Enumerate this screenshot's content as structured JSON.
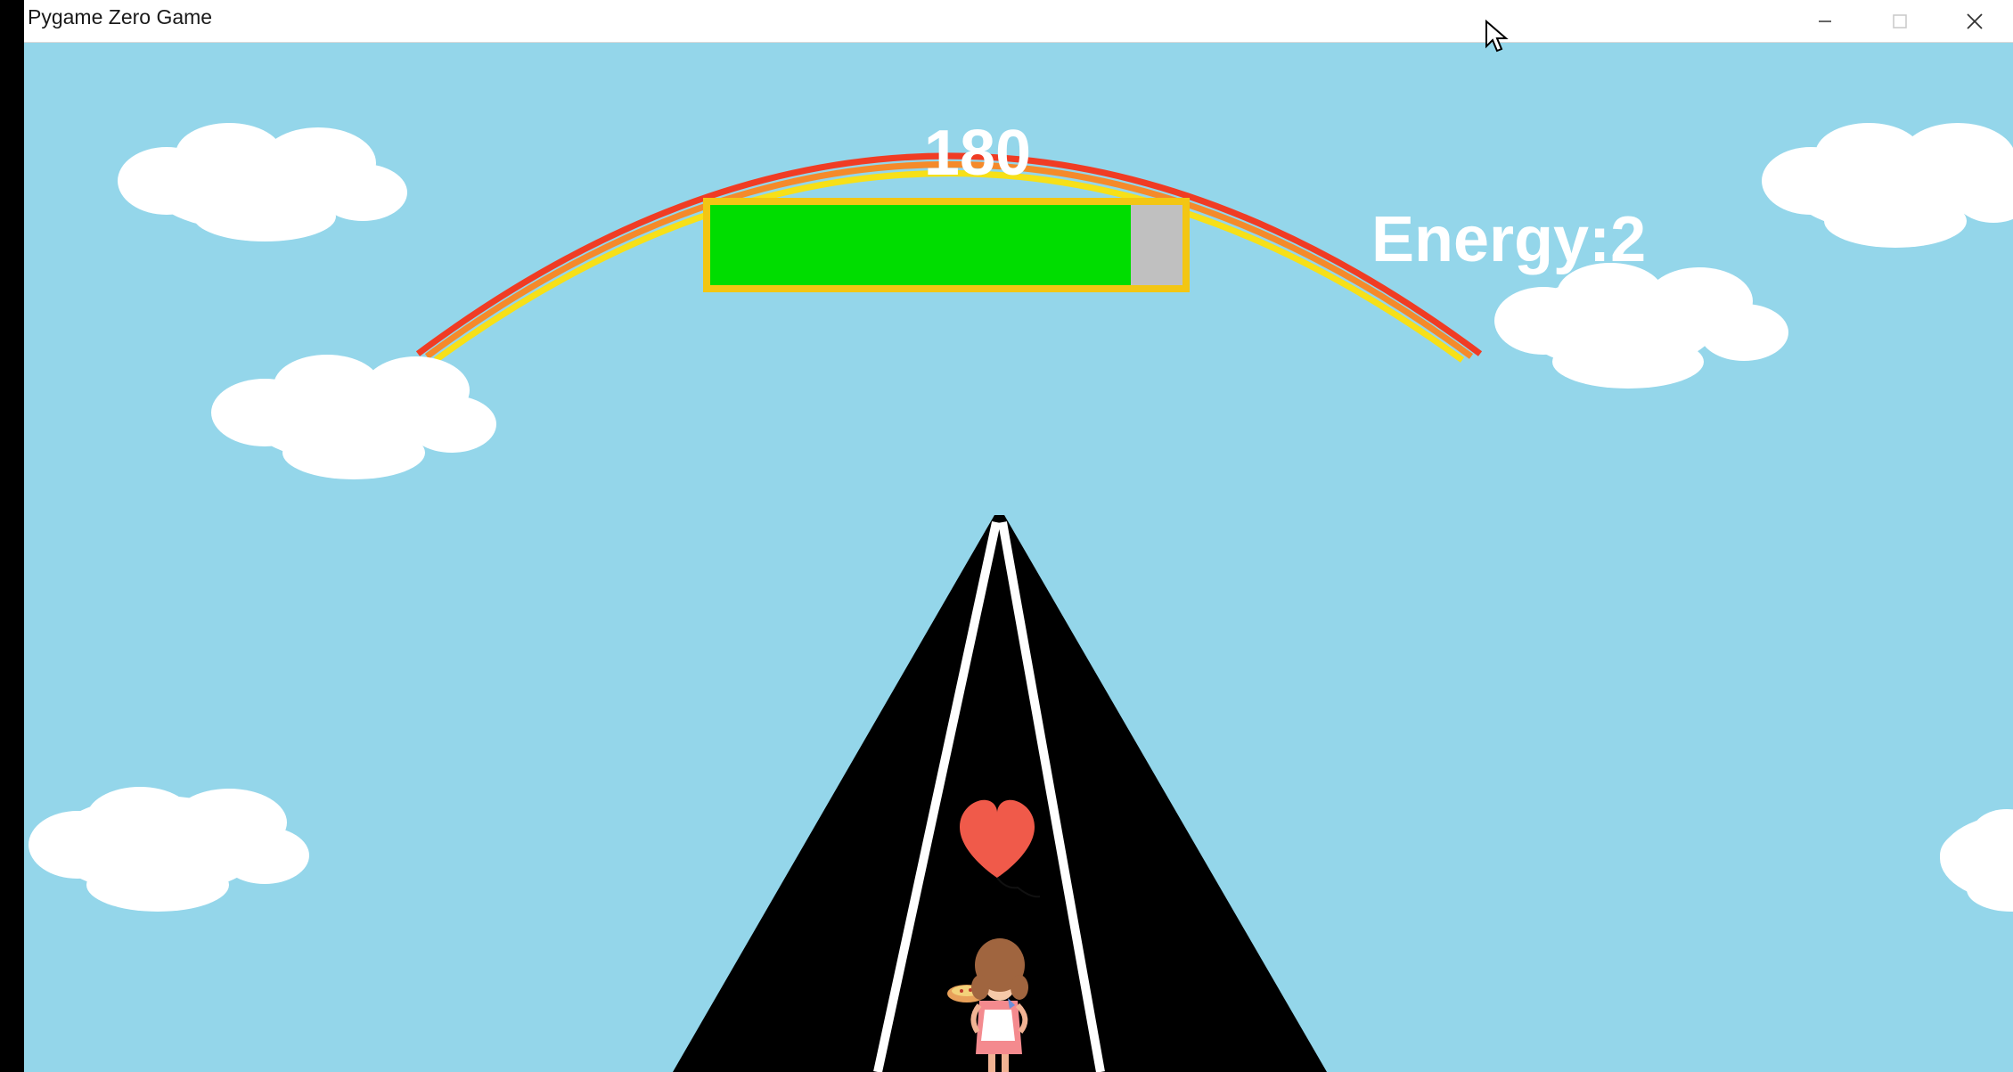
{
  "window": {
    "title": "Pygame Zero Game",
    "controls": [
      "minimize",
      "maximize",
      "close"
    ]
  },
  "hud": {
    "score": "180",
    "energy_label": "Energy:2",
    "energy_bar_fill_fraction": 0.89,
    "energy_bar_color": "#00dd00",
    "energy_bar_empty_color": "#c0c0c0",
    "energy_bar_border_color": "#f3c613"
  },
  "scene": {
    "sky_color": "#94d6ea",
    "road_color": "#000000",
    "lane_line_color": "#ffffff",
    "rainbow_colors": [
      "#f03c24",
      "#f58a2a",
      "#f7e018"
    ],
    "player": "girl-with-pie-icon",
    "pickup": "heart-icon"
  }
}
